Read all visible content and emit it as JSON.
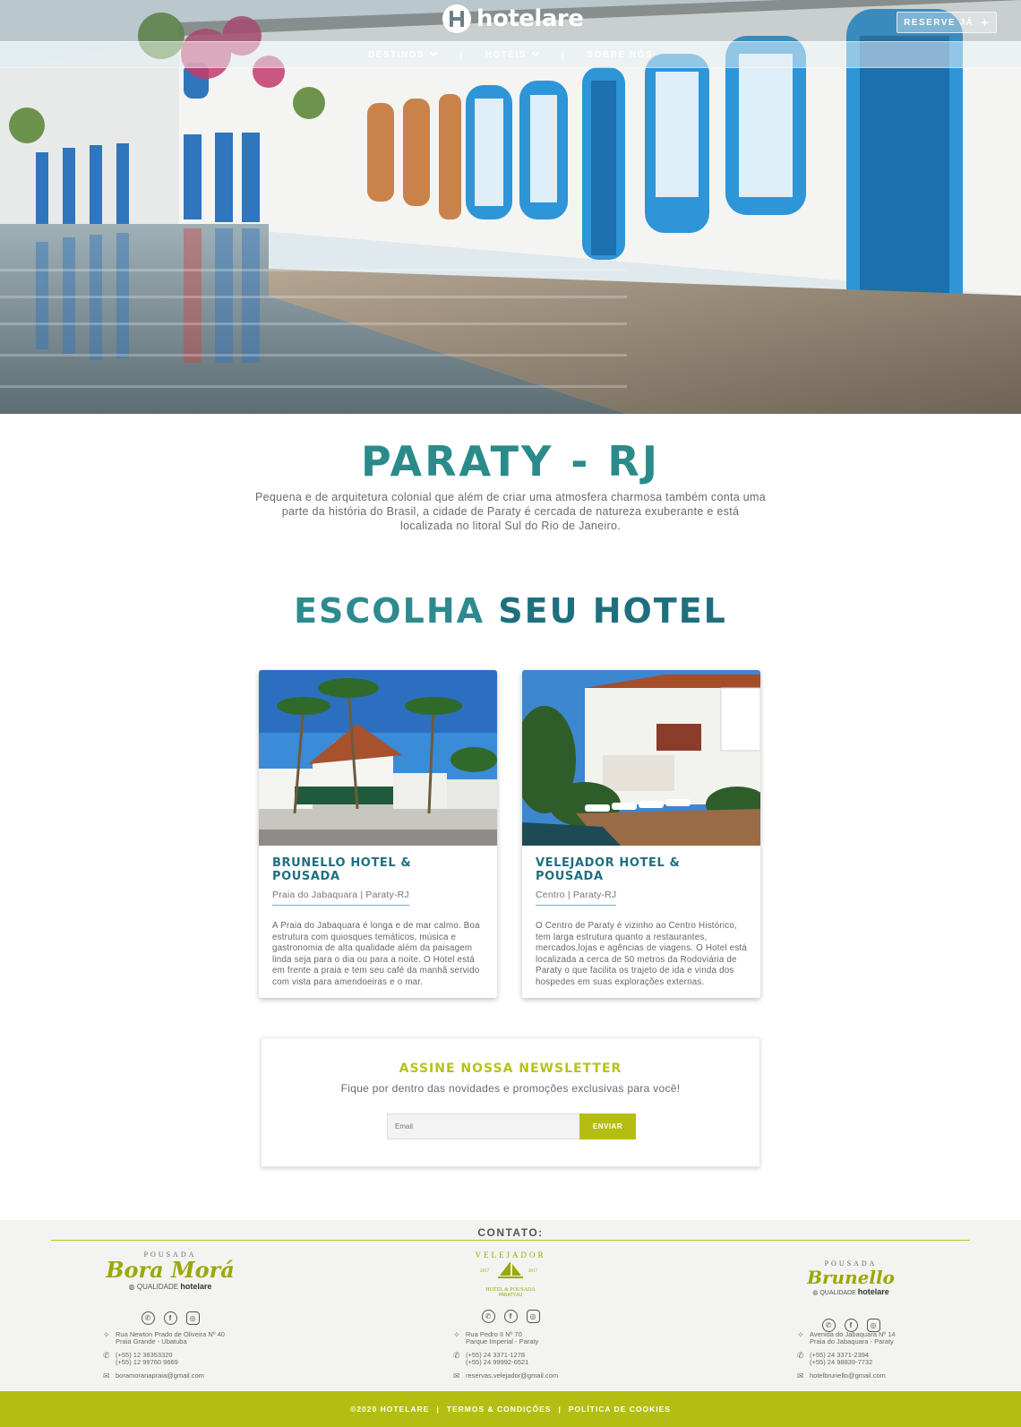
{
  "header": {
    "brand": "hotelare",
    "reserve_label": "RESERVE JÁ",
    "nav": [
      {
        "label": "DESTINOS"
      },
      {
        "label": "HOTÉIS"
      },
      {
        "label": "SOBRE NÓS"
      }
    ],
    "nav_separator": "|"
  },
  "destination": {
    "title": "PARATY - RJ",
    "description": "Pequena e de arquitetura colonial que além de criar uma atmosfera charmosa também conta uma parte da história do Brasil, a cidade de Paraty é cercada de natureza exuberante e está localizada no litoral Sul do Rio de Janeiro."
  },
  "hotels_section": {
    "title_part1": "ESCOLHA",
    "title_part2": "SEU HOTEL"
  },
  "hotels": [
    {
      "name": "BRUNELLO HOTEL & POUSADA",
      "location": "Praia do Jabaquara | Paraty-RJ",
      "description": "A Praia do Jabaquara é longa e de mar calmo. Boa estrutura com quiosques temáticos, música e gastronomia de alta qualidade além da paisagem linda seja para o dia ou para a noite. O Hotel está em frente a praia e tem seu café da manhã servido com vista para amendoeiras e o mar."
    },
    {
      "name": "VELEJADOR HOTEL & POUSADA",
      "location": "Centro | Paraty-RJ",
      "description": "O Centro de Paraty é vizinho ao Centro Histórico, tem larga estrutura quanto a restaurantes, mercados,lojas e agências de viagens. O Hotel está localizada a cerca de 50 metros da Rodoviária de Paraty o que facilita os trajeto de ida e vinda dos hospedes em suas explorações externas."
    }
  ],
  "newsletter": {
    "title": "ASSINE NOSSA NEWSLETTER",
    "subtitle": "Fique por dentro das novidades e promoções exclusivas para você!",
    "email_placeholder": "Email",
    "button_label": "ENVIAR"
  },
  "footer": {
    "contact_title": "CONTATO:",
    "columns": [
      {
        "brand_small": "POUSADA",
        "brand_name": "Bora Morá",
        "brand_quality": "QUALIDADE",
        "brand_by": "hotelare",
        "address1": "Rua Newton Prado de Oliveira Nº 40",
        "address2": "Praia Grande - Ubatuba",
        "phone1": "(+55) 12 38353320",
        "phone2": "(+55) 12 99760 9669",
        "email": "boramoranapraia@gmail.com"
      },
      {
        "brand_small": "VELEJADOR",
        "brand_name": "HOTEL & POUSADA",
        "brand_tag": "PARATY-RJ",
        "brand_year_left": "2017",
        "brand_year_right": "2017",
        "address1": "Rua Pedro II Nº 70",
        "address2": "Parque Imperial - Paraty",
        "phone1": "(+55) 24 3371-1278",
        "phone2": "(+55) 24 99992-6521",
        "email": "reservas.velejador@gmail.com"
      },
      {
        "brand_small": "POUSADA",
        "brand_name": "Brunello",
        "brand_quality": "QUALIDADE",
        "brand_by": "hotelare",
        "address1": "Avenida do Jabaquara Nº 14",
        "address2": "Praia do Jabaquara - Paraty",
        "phone1": "(+55) 24 3371-2394",
        "phone2": "(+55) 24 98839-7732",
        "email": "hotelbrunello@gmail.com"
      }
    ],
    "copyright": "©2020 HOTELARE",
    "terms": "TERMOS & CONDIÇÕES",
    "cookies": "POLÍTICA DE COOKIES",
    "separator": "|"
  },
  "colors": {
    "teal": "#2b8a8a",
    "dark_teal": "#1f6f7f",
    "lime": "#b4be12"
  }
}
